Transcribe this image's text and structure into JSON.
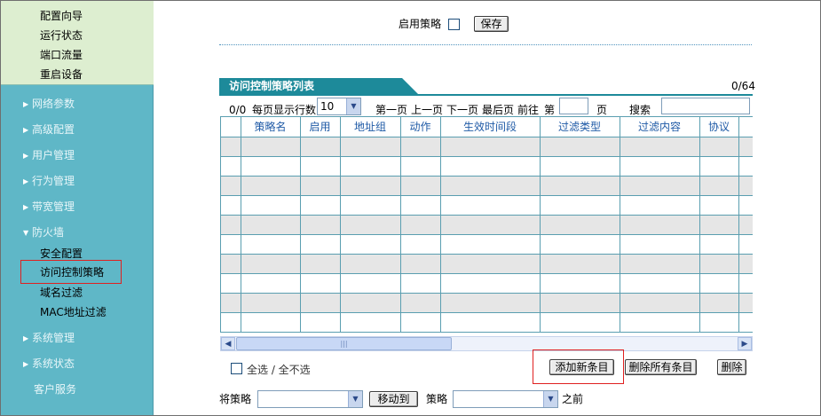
{
  "sidebar": {
    "top_items": [
      "配置向导",
      "运行状态",
      "端口流量",
      "重启设备"
    ],
    "sections": [
      "网络参数",
      "高级配置",
      "用户管理",
      "行为管理",
      "带宽管理"
    ],
    "firewall": {
      "label": "防火墙",
      "sub_items": [
        "安全配置",
        "访问控制策略",
        "域名过滤",
        "MAC地址过滤"
      ]
    },
    "bottom_sections": [
      "系统管理",
      "系统状态"
    ],
    "service": "客户服务",
    "expand_icon": "triangle-right-icon",
    "collapse_icon": "triangle-down-icon"
  },
  "policy": {
    "enable_label": "启用策略",
    "save_label": "保存"
  },
  "list": {
    "title": "访问控制策略列表",
    "count": "0/64",
    "pager": {
      "page_info": "0/0",
      "rows_per_page_label": "每页显示行数",
      "rows_per_page_value": "10",
      "first": "第一页",
      "prev": "上一页",
      "next": "下一页",
      "last": "最后页",
      "goto_label": "前往",
      "page_prefix": "第",
      "page_suffix": "页",
      "search_label": "搜索"
    },
    "columns": [
      "策略名",
      "启用",
      "地址组",
      "动作",
      "生效时间段",
      "过滤类型",
      "过滤内容",
      "协议"
    ],
    "row_count": 10
  },
  "actions": {
    "select_all": "全选 / 全不选",
    "add": "添加新条目",
    "delete_all": "删除所有条目",
    "delete": "删除"
  },
  "move": {
    "prefix": "将策略",
    "move_button": "移动到",
    "policy_label": "策略",
    "suffix": "之前"
  },
  "colors": {
    "sidebar_bg": "#5fb7c7",
    "tab_bg": "#1d8a9a",
    "highlight": "#e02020",
    "header_text": "#1f5aa6"
  }
}
